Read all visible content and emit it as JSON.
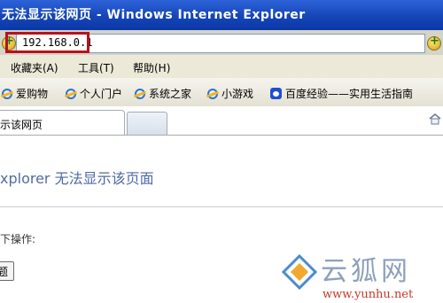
{
  "window": {
    "title": "无法显示该网页 - Windows Internet Explorer"
  },
  "address_bar": {
    "url": "192.168.0.1",
    "icons": [
      "ie-page-icon",
      "go-arrow-icon"
    ]
  },
  "menu": {
    "items": [
      {
        "label": "收藏夹(A)"
      },
      {
        "label": "工具(T)"
      },
      {
        "label": "帮助(H)"
      }
    ]
  },
  "favorites": {
    "items": [
      {
        "label": "爱购物",
        "icon": "ie-icon"
      },
      {
        "label": "个人门户",
        "icon": "ie-icon"
      },
      {
        "label": "系统之家",
        "icon": "ie-icon"
      },
      {
        "label": "小游戏",
        "icon": "ie-icon"
      },
      {
        "label": "百度经验——实用生活指南",
        "icon": "baidu-paw-icon"
      }
    ]
  },
  "tabs": {
    "active_label": "示该网页",
    "home_icon": "home-icon"
  },
  "content": {
    "title": "xplorer 无法显示该页面",
    "instruction": "下操作:",
    "button_label": "题"
  },
  "watermark": {
    "big_text": "云狐网",
    "url": "www.yunhu.net"
  }
}
